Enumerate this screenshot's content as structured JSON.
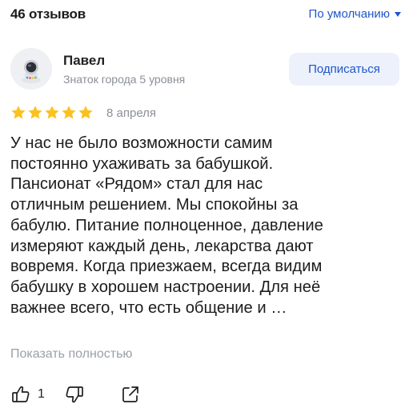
{
  "reviews_header": {
    "count_label": "46 отзывов",
    "sort_label": "По умолчанию"
  },
  "review": {
    "author": {
      "name": "Павел",
      "level": "Знаток города 5 уровня",
      "avatar_icon": "astronaut-avatar-icon"
    },
    "subscribe_label": "Подписаться",
    "rating": 5,
    "date": "8 апреля",
    "text": "У нас не было возможности самим\nпостоянно ухаживать за бабушкой.\nПансионат «Рядом» стал для нас\nотличным решением. Мы спокойны за\nбабулю. Питание полноценное, давление\nизмеряют каждый день, лекарства дают\nвовремя. Когда приезжаем, всегда видим\nбабушку в хорошем настроении. Для неё\nважнее всего, что есть общение и …",
    "show_full_label": "Показать полностью",
    "likes": "1"
  },
  "colors": {
    "accent": "#1f57c8",
    "star": "#fcc11f",
    "muted": "#8a8f98",
    "subscribe_bg": "#edf1fb"
  }
}
